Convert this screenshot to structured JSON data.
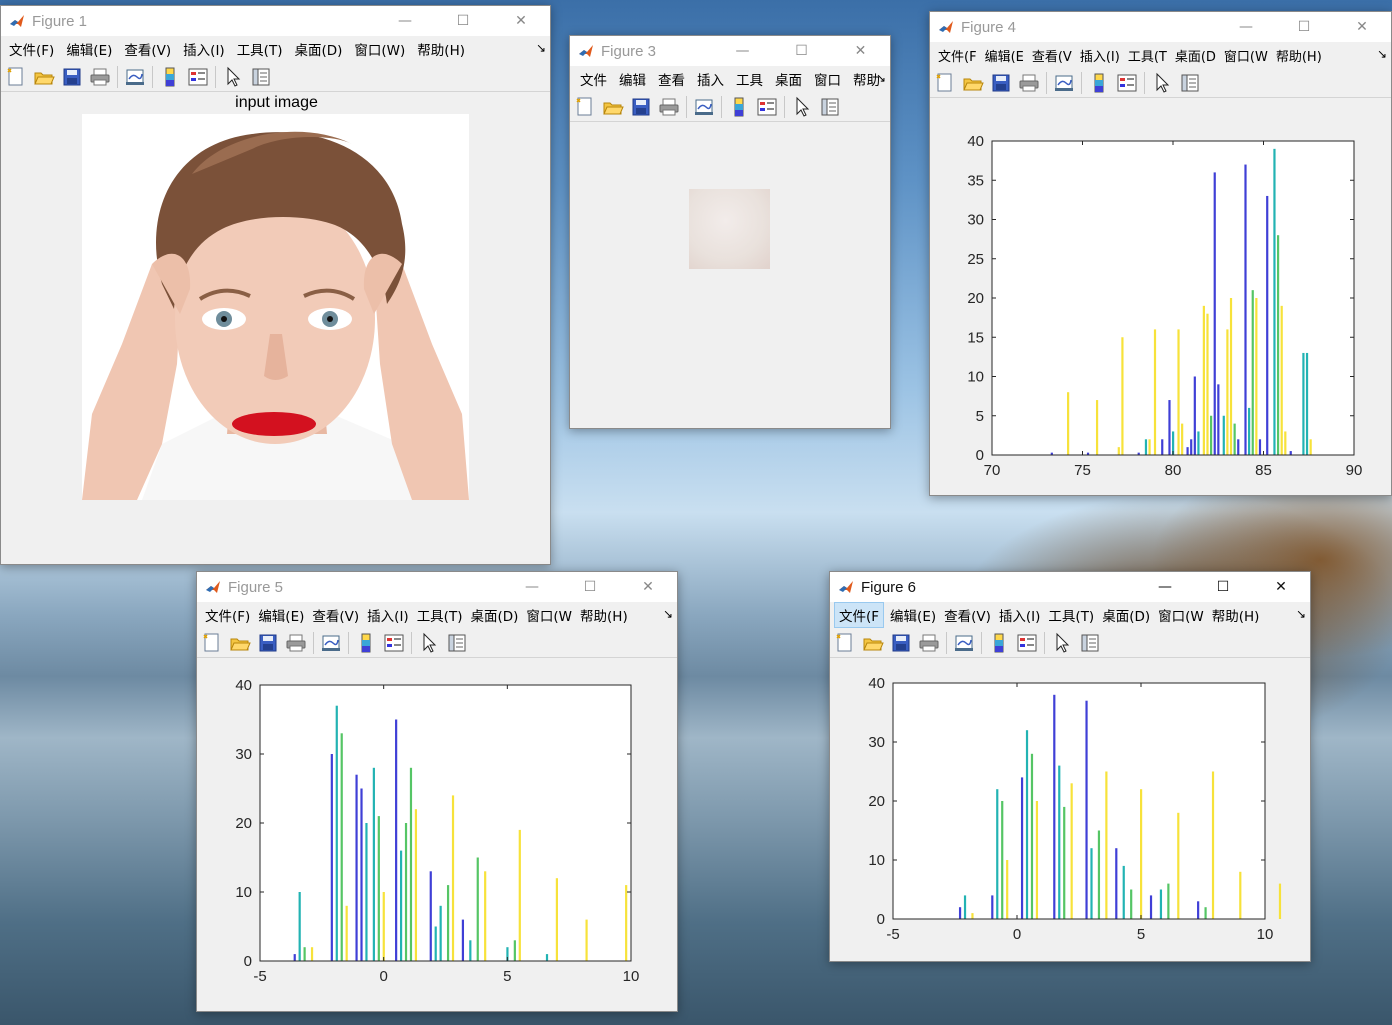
{
  "menu": [
    "文件(F)",
    "编辑(E)",
    "查看(V)",
    "插入(I)",
    "工具(T)",
    "桌面(D)",
    "窗口(W)",
    "帮助(H)"
  ],
  "menu_short": [
    "文件",
    "编辑",
    "查看",
    "插入",
    "工具",
    "桌面",
    "窗口",
    "帮助"
  ],
  "menu_clip": [
    "文件(F",
    "编辑(E",
    "查看(V",
    "插入(I)",
    "工具(T",
    "桌面(D",
    "窗口(W",
    "帮助(H)"
  ],
  "menu_clip_fig5": [
    "文件(F)",
    "编辑(E)",
    "查看(V)",
    "插入(I)",
    "工具(T)",
    "桌面(D)",
    "窗口(W",
    "帮助(H)"
  ],
  "menu_overflow": "↘",
  "toolbar_icons": [
    "new-figure-icon",
    "open-file-icon",
    "save-icon",
    "print-icon",
    "link-plot-icon",
    "colorbar-icon",
    "legend-icon",
    "pointer-icon",
    "plot-tools-icon"
  ],
  "window_controls": {
    "minimize": "—",
    "maximize": "☐",
    "close": "✕"
  },
  "colors": {
    "accent_blue": "#3f3fd6",
    "teal": "#22b3b3",
    "green": "#55c565",
    "yellow": "#f7e23a",
    "skin": "#efc9b4",
    "lips": "#d3111f",
    "hair": "#7b5139"
  },
  "windows": {
    "fig1": {
      "title": "Figure 1",
      "axes_title": "input image"
    },
    "fig3": {
      "title": "Figure 3"
    },
    "fig4": {
      "title": "Figure 4"
    },
    "fig5": {
      "title": "Figure 5"
    },
    "fig6": {
      "title": "Figure 6",
      "active": true
    }
  },
  "chart_data": [
    {
      "figure": "Figure 4",
      "type": "bar",
      "xlim": [
        70,
        90
      ],
      "ylim": [
        0,
        40
      ],
      "xticks": [
        70,
        75,
        80,
        85,
        90
      ],
      "yticks": [
        0,
        5,
        10,
        15,
        20,
        25,
        30,
        35,
        40
      ],
      "grid": false,
      "bars": [
        [
          73.3,
          0.3,
          "#3f3fd6"
        ],
        [
          74.2,
          8,
          "#f7e23a"
        ],
        [
          75.3,
          0.3,
          "#3f3fd6"
        ],
        [
          75.8,
          7,
          "#f7e23a"
        ],
        [
          77.0,
          1,
          "#f7e23a"
        ],
        [
          77.2,
          15,
          "#f7e23a"
        ],
        [
          78.1,
          0.3,
          "#3f3fd6"
        ],
        [
          78.5,
          2,
          "#22b3b3"
        ],
        [
          78.7,
          2,
          "#f7e23a"
        ],
        [
          79.0,
          16,
          "#f7e23a"
        ],
        [
          79.4,
          2,
          "#3f3fd6"
        ],
        [
          79.8,
          7,
          "#3f3fd6"
        ],
        [
          80.0,
          3,
          "#22b3b3"
        ],
        [
          80.3,
          16,
          "#f7e23a"
        ],
        [
          80.5,
          4,
          "#f7e23a"
        ],
        [
          80.8,
          1,
          "#3f3fd6"
        ],
        [
          81.0,
          2,
          "#3f3fd6"
        ],
        [
          81.2,
          10,
          "#3f3fd6"
        ],
        [
          81.4,
          3,
          "#22b3b3"
        ],
        [
          81.7,
          19,
          "#f7e23a"
        ],
        [
          81.9,
          18,
          "#f7e23a"
        ],
        [
          82.1,
          5,
          "#55c565"
        ],
        [
          82.3,
          36,
          "#3f3fd6"
        ],
        [
          82.5,
          9,
          "#3f3fd6"
        ],
        [
          82.8,
          5,
          "#22b3b3"
        ],
        [
          83.0,
          16,
          "#f7e23a"
        ],
        [
          83.2,
          20,
          "#f7e23a"
        ],
        [
          83.4,
          4,
          "#55c565"
        ],
        [
          83.6,
          2,
          "#3f3fd6"
        ],
        [
          84.0,
          37,
          "#3f3fd6"
        ],
        [
          84.2,
          6,
          "#22b3b3"
        ],
        [
          84.4,
          21,
          "#55c565"
        ],
        [
          84.6,
          20,
          "#f7e23a"
        ],
        [
          84.8,
          2,
          "#3f3fd6"
        ],
        [
          85.2,
          33,
          "#3f3fd6"
        ],
        [
          85.6,
          39,
          "#22b3b3"
        ],
        [
          85.8,
          28,
          "#55c565"
        ],
        [
          86.0,
          19,
          "#f7e23a"
        ],
        [
          86.2,
          3,
          "#f7e23a"
        ],
        [
          86.5,
          0.5,
          "#3f3fd6"
        ],
        [
          87.2,
          13,
          "#22b3b3"
        ],
        [
          87.4,
          13,
          "#22b3b3"
        ],
        [
          87.6,
          2,
          "#f7e23a"
        ]
      ]
    },
    {
      "figure": "Figure 5",
      "type": "bar",
      "xlim": [
        -5,
        10
      ],
      "ylim": [
        0,
        40
      ],
      "xticks": [
        -5,
        0,
        5,
        10
      ],
      "yticks": [
        0,
        10,
        20,
        30,
        40
      ],
      "grid": false,
      "bars": [
        [
          -3.6,
          1,
          "#3f3fd6"
        ],
        [
          -3.4,
          10,
          "#22b3b3"
        ],
        [
          -3.2,
          2,
          "#55c565"
        ],
        [
          -2.9,
          2,
          "#f7e23a"
        ],
        [
          -2.1,
          30,
          "#3f3fd6"
        ],
        [
          -1.9,
          37,
          "#22b3b3"
        ],
        [
          -1.7,
          33,
          "#55c565"
        ],
        [
          -1.5,
          8,
          "#f7e23a"
        ],
        [
          -1.1,
          27,
          "#3f3fd6"
        ],
        [
          -0.9,
          25,
          "#3f3fd6"
        ],
        [
          -0.7,
          20,
          "#22b3b3"
        ],
        [
          -0.4,
          28,
          "#22b3b3"
        ],
        [
          -0.2,
          21,
          "#55c565"
        ],
        [
          0.0,
          10,
          "#f7e23a"
        ],
        [
          0.5,
          35,
          "#3f3fd6"
        ],
        [
          0.7,
          16,
          "#22b3b3"
        ],
        [
          0.9,
          20,
          "#55c565"
        ],
        [
          1.1,
          28,
          "#55c565"
        ],
        [
          1.3,
          22,
          "#f7e23a"
        ],
        [
          1.9,
          13,
          "#3f3fd6"
        ],
        [
          2.1,
          5,
          "#22b3b3"
        ],
        [
          2.3,
          8,
          "#22b3b3"
        ],
        [
          2.6,
          11,
          "#55c565"
        ],
        [
          2.8,
          24,
          "#f7e23a"
        ],
        [
          3.2,
          6,
          "#3f3fd6"
        ],
        [
          3.5,
          3,
          "#22b3b3"
        ],
        [
          3.8,
          15,
          "#55c565"
        ],
        [
          4.1,
          13,
          "#f7e23a"
        ],
        [
          5.0,
          2,
          "#22b3b3"
        ],
        [
          5.3,
          3,
          "#55c565"
        ],
        [
          5.5,
          19,
          "#f7e23a"
        ],
        [
          6.6,
          1,
          "#22b3b3"
        ],
        [
          7.0,
          12,
          "#f7e23a"
        ],
        [
          8.2,
          6,
          "#f7e23a"
        ],
        [
          9.8,
          11,
          "#f7e23a"
        ]
      ]
    },
    {
      "figure": "Figure 6",
      "type": "bar",
      "xlim": [
        -5,
        10
      ],
      "ylim": [
        0,
        40
      ],
      "xticks": [
        -5,
        0,
        5,
        10
      ],
      "yticks": [
        0,
        10,
        20,
        30,
        40
      ],
      "grid": false,
      "bars": [
        [
          -2.3,
          2,
          "#3f3fd6"
        ],
        [
          -2.1,
          4,
          "#22b3b3"
        ],
        [
          -1.8,
          1,
          "#f7e23a"
        ],
        [
          -1.0,
          4,
          "#3f3fd6"
        ],
        [
          -0.8,
          22,
          "#22b3b3"
        ],
        [
          -0.6,
          20,
          "#55c565"
        ],
        [
          -0.4,
          10,
          "#f7e23a"
        ],
        [
          0.2,
          24,
          "#3f3fd6"
        ],
        [
          0.4,
          32,
          "#22b3b3"
        ],
        [
          0.6,
          28,
          "#55c565"
        ],
        [
          0.8,
          20,
          "#f7e23a"
        ],
        [
          1.5,
          38,
          "#3f3fd6"
        ],
        [
          1.7,
          26,
          "#22b3b3"
        ],
        [
          1.9,
          19,
          "#55c565"
        ],
        [
          2.2,
          23,
          "#f7e23a"
        ],
        [
          2.8,
          37,
          "#3f3fd6"
        ],
        [
          3.0,
          12,
          "#22b3b3"
        ],
        [
          3.3,
          15,
          "#55c565"
        ],
        [
          3.6,
          25,
          "#f7e23a"
        ],
        [
          4.0,
          12,
          "#3f3fd6"
        ],
        [
          4.3,
          9,
          "#22b3b3"
        ],
        [
          4.6,
          5,
          "#55c565"
        ],
        [
          5.0,
          22,
          "#f7e23a"
        ],
        [
          5.4,
          4,
          "#3f3fd6"
        ],
        [
          5.8,
          5,
          "#22b3b3"
        ],
        [
          6.1,
          6,
          "#55c565"
        ],
        [
          6.5,
          18,
          "#f7e23a"
        ],
        [
          7.3,
          3,
          "#3f3fd6"
        ],
        [
          7.6,
          2,
          "#55c565"
        ],
        [
          7.9,
          25,
          "#f7e23a"
        ],
        [
          9.0,
          8,
          "#f7e23a"
        ],
        [
          10.6,
          6,
          "#f7e23a"
        ]
      ]
    }
  ]
}
